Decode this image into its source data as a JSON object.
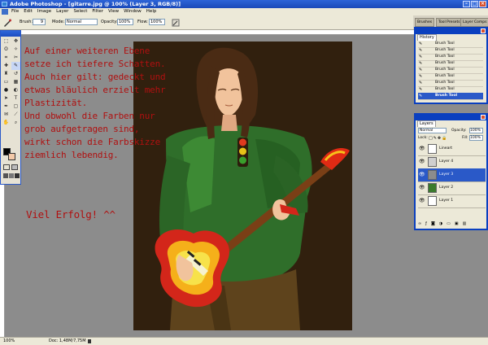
{
  "window": {
    "title": "Adobe Photoshop - [gitarre.jpg @ 100% (Layer 3, RGB/8)]"
  },
  "menu": [
    "File",
    "Edit",
    "Image",
    "Layer",
    "Select",
    "Filter",
    "View",
    "Window",
    "Help"
  ],
  "options": {
    "brush_label": "Brush:",
    "brush_size": "9",
    "mode_label": "Mode:",
    "mode_value": "Normal",
    "opacity_label": "Opacity:",
    "opacity_value": "100%",
    "flow_label": "Flow:",
    "flow_value": "100%"
  },
  "palette_well": {
    "tabs": [
      "Brushes",
      "Tool Presets",
      "Layer Comps"
    ]
  },
  "overlay_text": {
    "lines": [
      "Auf einer weiteren Ebene",
      "setze ich tiefere Schatten.",
      "Auch hier gilt: gedeckt und",
      "etwas bläulich erzielt mehr",
      "Plastizität.",
      "Und obwohl die Farben nur",
      "grob aufgetragen sind,",
      "wirkt schon die Farbskizze",
      "ziemlich lebendig."
    ],
    "closing": "Viel Erfolg! ^^"
  },
  "history": {
    "title": "History",
    "items": [
      "Brush Tool",
      "Brush Tool",
      "Brush Tool",
      "Brush Tool",
      "Brush Tool",
      "Brush Tool",
      "Brush Tool",
      "Brush Tool",
      "Brush Tool"
    ],
    "selected_index": 8
  },
  "layers": {
    "title": "Layers",
    "mode_value": "Normal",
    "opacity_label": "Opacity:",
    "opacity_value": "100%",
    "lock_label": "Lock:",
    "fill_label": "Fill:",
    "fill_value": "100%",
    "items": [
      {
        "name": "Lineart"
      },
      {
        "name": "Layer 4"
      },
      {
        "name": "Layer 3"
      },
      {
        "name": "Layer 2"
      },
      {
        "name": "Layer 1"
      }
    ],
    "selected_index": 2
  },
  "status": {
    "zoom": "100%",
    "doc": "Doc: 1,48M/7,75M"
  },
  "colors": {
    "foreground": "#000000",
    "background": "#f3c9a8",
    "overlay_text": "#b01010",
    "canvas": "#31200e"
  },
  "icons": [
    "move-icon",
    "marquee-icon",
    "lasso-icon",
    "magic-wand-icon",
    "crop-icon",
    "slice-icon",
    "healing-icon",
    "brush-icon",
    "stamp-icon",
    "history-brush-icon",
    "eraser-icon",
    "gradient-icon",
    "blur-icon",
    "dodge-icon",
    "path-icon",
    "type-icon",
    "pen-icon",
    "shape-icon",
    "notes-icon",
    "eyedropper-icon",
    "hand-icon",
    "zoom-icon",
    "eye-icon",
    "chain-icon",
    "trash-icon"
  ]
}
